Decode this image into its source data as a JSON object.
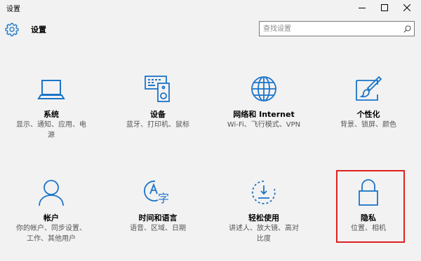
{
  "window": {
    "title": "设置",
    "accent_color": "#1b74c9",
    "highlight_color": "#e02020"
  },
  "header": {
    "title": "设置",
    "icon": "gear-icon"
  },
  "search": {
    "placeholder": "查找设置",
    "value": "",
    "icon": "search-icon"
  },
  "tiles": [
    {
      "name": "系统",
      "description": "显示、通知、应用、电源",
      "icon": "laptop-icon"
    },
    {
      "name": "设备",
      "description": "蓝牙、打印机、鼠标",
      "icon": "keyboard-speaker-icon"
    },
    {
      "name": "网络和 Internet",
      "description": "Wi-Fi、飞行模式、VPN",
      "icon": "globe-icon"
    },
    {
      "name": "个性化",
      "description": "背景、锁屏、颜色",
      "icon": "paintbrush-icon"
    },
    {
      "name": "帐户",
      "description": "你的帐户、同步设置、工作、其他用户",
      "icon": "person-icon"
    },
    {
      "name": "时间和语言",
      "description": "语音、区域、日期",
      "icon": "time-language-icon"
    },
    {
      "name": "轻松使用",
      "description": "讲述人、放大镜、高对比度",
      "icon": "ease-of-access-icon"
    },
    {
      "name": "隐私",
      "description": "位置、相机",
      "icon": "lock-icon"
    }
  ]
}
